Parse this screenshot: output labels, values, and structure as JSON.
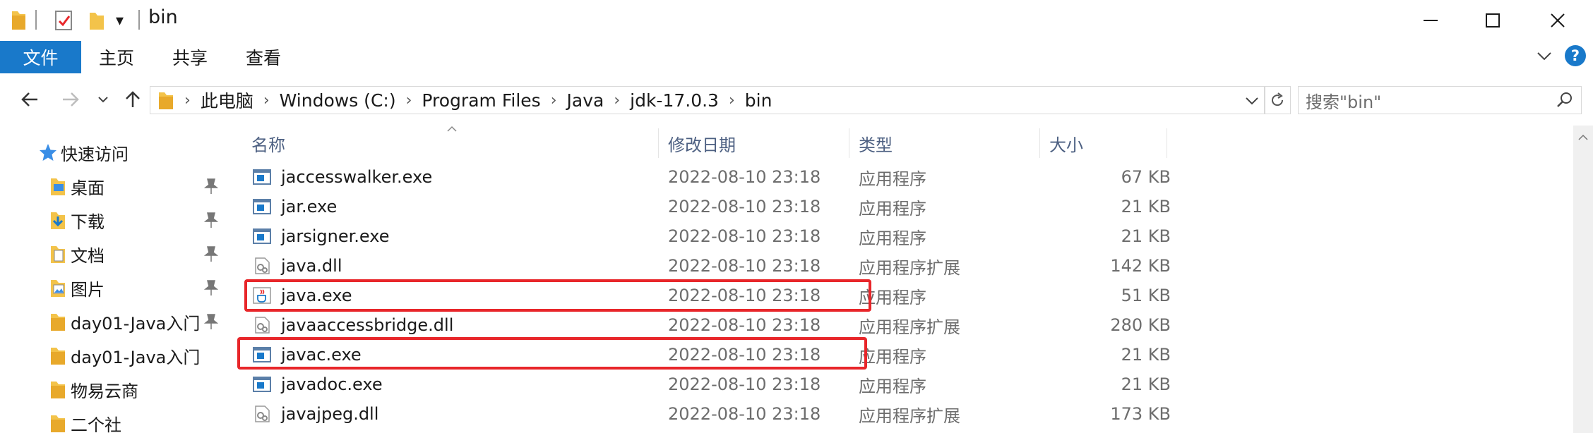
{
  "window": {
    "title": "bin",
    "dropdown_glyph": "▾"
  },
  "ribbon": {
    "file": "文件",
    "home": "主页",
    "share": "共享",
    "view": "查看",
    "help": "?"
  },
  "address": {
    "crumbs": [
      "此电脑",
      "Windows (C:)",
      "Program Files",
      "Java",
      "jdk-17.0.3",
      "bin"
    ],
    "search_placeholder": "搜索\"bin\""
  },
  "sidebar": {
    "quick_access": "快速访问",
    "items": [
      {
        "label": "桌面",
        "pinned": true
      },
      {
        "label": "下载",
        "pinned": true
      },
      {
        "label": "文档",
        "pinned": true
      },
      {
        "label": "图片",
        "pinned": true
      },
      {
        "label": "day01-Java入门",
        "pinned": true
      },
      {
        "label": "day01-Java入门",
        "pinned": false
      },
      {
        "label": "物易云商",
        "pinned": false
      },
      {
        "label": "二个社",
        "pinned": false
      }
    ]
  },
  "columns": {
    "name": "名称",
    "date": "修改日期",
    "type": "类型",
    "size": "大小"
  },
  "files": [
    {
      "name": "jaccesswalker.exe",
      "date": "2022-08-10 23:18",
      "type": "应用程序",
      "size": "67 KB",
      "icon": "exe-icon"
    },
    {
      "name": "jar.exe",
      "date": "2022-08-10 23:18",
      "type": "应用程序",
      "size": "21 KB",
      "icon": "exe-icon"
    },
    {
      "name": "jarsigner.exe",
      "date": "2022-08-10 23:18",
      "type": "应用程序",
      "size": "21 KB",
      "icon": "exe-icon"
    },
    {
      "name": "java.dll",
      "date": "2022-08-10 23:18",
      "type": "应用程序扩展",
      "size": "142 KB",
      "icon": "dll-icon"
    },
    {
      "name": "java.exe",
      "date": "2022-08-10 23:18",
      "type": "应用程序",
      "size": "51 KB",
      "icon": "java-cup-icon"
    },
    {
      "name": "javaaccessbridge.dll",
      "date": "2022-08-10 23:18",
      "type": "应用程序扩展",
      "size": "280 KB",
      "icon": "dll-icon"
    },
    {
      "name": "javac.exe",
      "date": "2022-08-10 23:18",
      "type": "应用程序",
      "size": "21 KB",
      "icon": "exe-icon"
    },
    {
      "name": "javadoc.exe",
      "date": "2022-08-10 23:18",
      "type": "应用程序",
      "size": "21 KB",
      "icon": "exe-icon"
    },
    {
      "name": "javajpeg.dll",
      "date": "2022-08-10 23:18",
      "type": "应用程序扩展",
      "size": "173 KB",
      "icon": "dll-icon"
    }
  ],
  "colors": {
    "accent": "#1979ca",
    "highlight": "#e8262a",
    "folder": "#f3c34a"
  }
}
